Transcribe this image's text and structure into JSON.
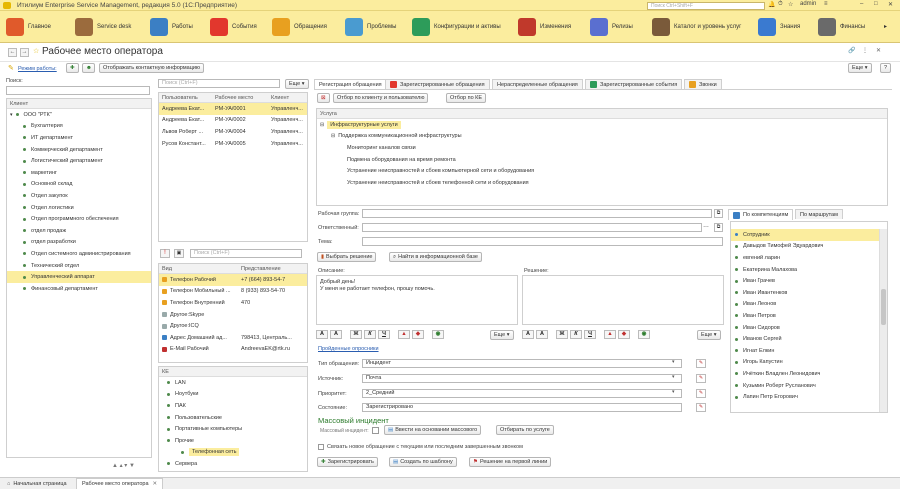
{
  "app": {
    "title": "Итилиум Enterprise Service Management, редакция 5.0  (1С:Предприятие)",
    "search_placeholder": "Поиск Ctrl+Shift+F",
    "user": "admin"
  },
  "sections": [
    {
      "label": "Главное",
      "color": "#e05a2b"
    },
    {
      "label": "Service desk",
      "color": "#9b6b3d"
    },
    {
      "label": "Работы",
      "color": "#3b7fc4"
    },
    {
      "label": "События",
      "color": "#e2372d"
    },
    {
      "label": "Обращения",
      "color": "#e8a020"
    },
    {
      "label": "Проблемы",
      "color": "#4a9bd0"
    },
    {
      "label": "Конфигурации и активы",
      "color": "#2d9c5a"
    },
    {
      "label": "Изменения",
      "color": "#c0392b"
    },
    {
      "label": "Релизы",
      "color": "#5a6fd0"
    },
    {
      "label": "Каталог и уровень услуг",
      "color": "#7a5a3a"
    },
    {
      "label": "Знания",
      "color": "#3a7ad0"
    },
    {
      "label": "Финансы",
      "color": "#6a6a6a"
    }
  ],
  "form": {
    "title": "Рабочее место оператора",
    "mode_label": "Режим работы:",
    "show_contact": "Отображать контактную информацию",
    "more": "Еще",
    "help": "?"
  },
  "left": {
    "search_label": "Поиск:",
    "column": "Клиент",
    "root": "ООО \"РТК\"",
    "items": [
      "Бухгалтерия",
      "ИТ департамент",
      "Коммерческий департамент",
      "Логистический департамент",
      "маркетинг",
      "Основной склад",
      "Отдел закупок",
      "Отдел логистики",
      "Отдел программного обеспечения",
      "отдел продаж",
      "отдел разработки",
      "Отдел системного администрирования",
      "Технический отдел",
      "Управленческий аппарат",
      "Финансовый департамент"
    ],
    "selected_index": 13
  },
  "users": {
    "search_placeholder": "Поиск (Ctrl+F)",
    "more": "Еще",
    "columns": [
      "Пользователь",
      "Рабочее место",
      "Клиент"
    ],
    "rows": [
      [
        "Андреева Екат...",
        "PM-УА/0001",
        "Управленч..."
      ],
      [
        "Андреева Екат...",
        "PM-УА/0002",
        "Управленч..."
      ],
      [
        "Львов Роберт ...",
        "PM-УА/0004",
        "Управленч..."
      ],
      [
        "Русов Констант...",
        "PM-УА/0005",
        "Управленч..."
      ]
    ]
  },
  "contacts": {
    "search_placeholder": "Поиск (Ctrl+F)",
    "columns": [
      "Вид",
      "Представление"
    ],
    "rows": [
      [
        "Телефон Рабочий",
        "+7 (664) 893-54-7"
      ],
      [
        "Телефон Мобильный ...",
        "8 (933) 893-54-70"
      ],
      [
        "Телефон Внутренний",
        "470"
      ],
      [
        "Другое:Skype",
        ""
      ],
      [
        "Другое:ICQ",
        ""
      ],
      [
        "Адрес Домашний ад...",
        "798413, Централь..."
      ],
      [
        "E-Mail Рабочий",
        "AndreevaEK@rtk.ru"
      ]
    ]
  },
  "ke": {
    "column": "КЕ",
    "items": [
      "LAN",
      "Ноутбуки",
      "ПАК",
      "Пользовательские",
      "Портативные компьютеры",
      "Прочие",
      "Телефонная сеть",
      "Сервера"
    ]
  },
  "tabs": [
    "Регистрация обращения",
    "Зарегистрированные обращения",
    "Нераспределенные обращения",
    "Зарегистрированные события",
    "Звонки"
  ],
  "filters": {
    "by_client": "Отбор по клиенту и пользователю",
    "by_ke": "Отбор по КЕ"
  },
  "services": {
    "column": "Услуга",
    "items": [
      "Инфраструктурные услуги",
      "Поддержка коммуникационной инфраструктуры",
      "Мониторинг каналов связи",
      "Подмена оборудования на время ремонта",
      "Устранение неисправностей и сбоев компьютерной сети и оборудования",
      "Устранение неисправностей и сбоев телефонной сети и оборудования"
    ]
  },
  "reg": {
    "workgroup": "Рабочая группа:",
    "responsible": "Ответственный:",
    "topic": "Тема:",
    "choose_solution": "Выбрать решение",
    "find_kb": "Найти в информационной базе",
    "description_label": "Описание:",
    "description": "Добрый день!\nУ меня не работает телефон, прошу помочь.",
    "solution_label": "Решение:",
    "more": "Еще",
    "surveys": "Пройденные опросники",
    "type_label": "Тип обращения:",
    "type": "Инцидент",
    "source_label": "Источник:",
    "source": "Почта",
    "priority_label": "Приоритет:",
    "priority": "2_Средний",
    "state_label": "Состояние:",
    "state": "Зарегистрировано",
    "mass_title": "Массовый инцидент",
    "mass_label": "Массовый инцидент:",
    "mass_enter": "Ввести на основании массового",
    "mass_filter": "Отбирать по услуге",
    "link_call": "Связать новое обращение с текущим или последним завершенным звонком",
    "register": "Зарегистрировать",
    "create_template": "Создать по шаблону",
    "first_line": "Решение на первой линии"
  },
  "employees": {
    "tabs": [
      "По компетенциям",
      "По маршрутам"
    ],
    "column": "Сотрудник",
    "items": [
      "Давыдов Тимофей Эдуардович",
      "евгений ларин",
      "Екатерина Малахова",
      "Иван Грачев",
      "Иван Ивантенков",
      "Иван Леонов",
      "Иван Петров",
      "Иван Сидоров",
      "Иванов Сергей",
      "Игнат Елкин",
      "Игорь Капустин",
      "Ичёткин Владлен Леонидович",
      "Кузьмин Роберт Русланович",
      "Лапин Петр Егорович"
    ]
  },
  "bottom": {
    "tabs": [
      "Начальная страница",
      "Рабочее место оператора"
    ]
  }
}
